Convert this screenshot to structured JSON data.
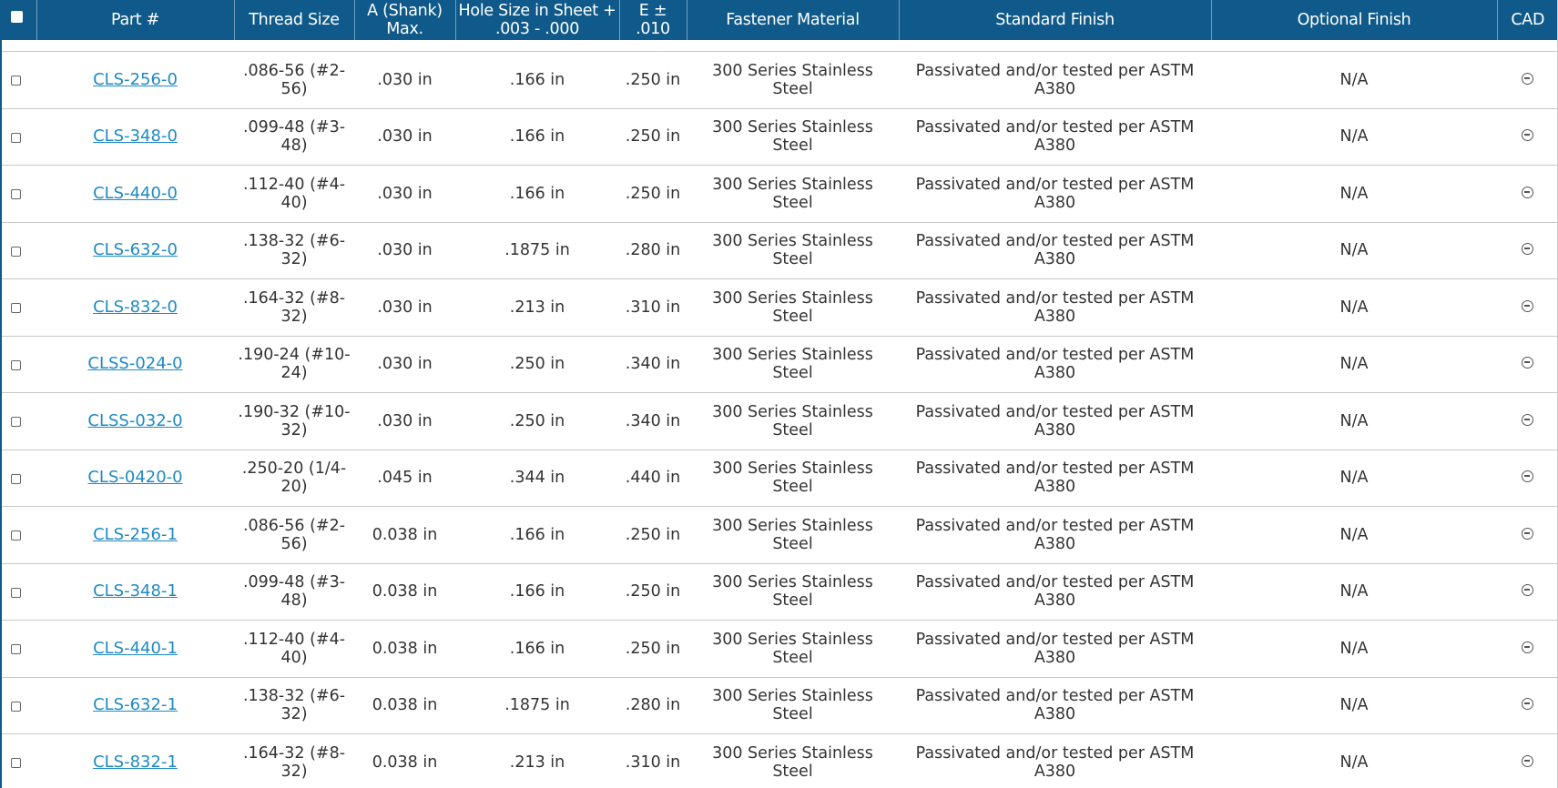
{
  "table": {
    "headers": [
      "",
      "Part #",
      "Thread Size",
      "A (Shank) Max.",
      "Hole Size in Sheet + .003 - .000",
      "E ± .010",
      "Fastener Material",
      "Standard Finish",
      "Optional Finish",
      "CAD"
    ],
    "header_color": "#0f5a8a",
    "link_color": "#1f8ac2",
    "rows": [
      {
        "part": "CLS-256-0",
        "thread": ".086-56 (#2-56)",
        "shank": ".030 in",
        "hole": ".166 in",
        "e": ".250 in",
        "material": "300 Series Stainless Steel",
        "std_finish": "Passivated and/or tested per ASTM A380",
        "opt_finish": "N/A",
        "cad": "cad-icon"
      },
      {
        "part": "CLS-348-0",
        "thread": ".099-48 (#3-48)",
        "shank": ".030 in",
        "hole": ".166 in",
        "e": ".250 in",
        "material": "300 Series Stainless Steel",
        "std_finish": "Passivated and/or tested per ASTM A380",
        "opt_finish": "N/A",
        "cad": "cad-icon"
      },
      {
        "part": "CLS-440-0",
        "thread": ".112-40 (#4-40)",
        "shank": ".030 in",
        "hole": ".166 in",
        "e": ".250 in",
        "material": "300 Series Stainless Steel",
        "std_finish": "Passivated and/or tested per ASTM A380",
        "opt_finish": "N/A",
        "cad": "cad-icon"
      },
      {
        "part": "CLS-632-0",
        "thread": ".138-32 (#6-32)",
        "shank": ".030 in",
        "hole": ".1875 in",
        "e": ".280 in",
        "material": "300 Series Stainless Steel",
        "std_finish": "Passivated and/or tested per ASTM A380",
        "opt_finish": "N/A",
        "cad": "cad-icon"
      },
      {
        "part": "CLS-832-0",
        "thread": ".164-32 (#8-32)",
        "shank": ".030 in",
        "hole": ".213 in",
        "e": ".310 in",
        "material": "300 Series Stainless Steel",
        "std_finish": "Passivated and/or tested per ASTM A380",
        "opt_finish": "N/A",
        "cad": "cad-icon"
      },
      {
        "part": "CLSS-024-0",
        "thread": ".190-24 (#10-24)",
        "shank": ".030 in",
        "hole": ".250 in",
        "e": ".340 in",
        "material": "300 Series Stainless Steel",
        "std_finish": "Passivated and/or tested per ASTM A380",
        "opt_finish": "N/A",
        "cad": "cad-icon"
      },
      {
        "part": "CLSS-032-0",
        "thread": ".190-32 (#10-32)",
        "shank": ".030 in",
        "hole": ".250 in",
        "e": ".340 in",
        "material": "300 Series Stainless Steel",
        "std_finish": "Passivated and/or tested per ASTM A380",
        "opt_finish": "N/A",
        "cad": "cad-icon"
      },
      {
        "part": "CLS-0420-0",
        "thread": ".250-20 (1/4-20)",
        "shank": ".045 in",
        "hole": ".344 in",
        "e": ".440 in",
        "material": "300 Series Stainless Steel",
        "std_finish": "Passivated and/or tested per ASTM A380",
        "opt_finish": "N/A",
        "cad": "cad-icon"
      },
      {
        "part": "CLS-256-1",
        "thread": ".086-56 (#2-56)",
        "shank": "0.038 in",
        "hole": ".166 in",
        "e": ".250 in",
        "material": "300 Series Stainless Steel",
        "std_finish": "Passivated and/or tested per ASTM A380",
        "opt_finish": "N/A",
        "cad": "cad-icon"
      },
      {
        "part": "CLS-348-1",
        "thread": ".099-48 (#3-48)",
        "shank": "0.038 in",
        "hole": ".166 in",
        "e": ".250 in",
        "material": "300 Series Stainless Steel",
        "std_finish": "Passivated and/or tested per ASTM A380",
        "opt_finish": "N/A",
        "cad": "cad-icon"
      },
      {
        "part": "CLS-440-1",
        "thread": ".112-40 (#4-40)",
        "shank": "0.038 in",
        "hole": ".166 in",
        "e": ".250 in",
        "material": "300 Series Stainless Steel",
        "std_finish": "Passivated and/or tested per ASTM A380",
        "opt_finish": "N/A",
        "cad": "cad-icon"
      },
      {
        "part": "CLS-632-1",
        "thread": ".138-32 (#6-32)",
        "shank": "0.038 in",
        "hole": ".1875 in",
        "e": ".280 in",
        "material": "300 Series Stainless Steel",
        "std_finish": "Passivated and/or tested per ASTM A380",
        "opt_finish": "N/A",
        "cad": "cad-icon"
      },
      {
        "part": "CLS-832-1",
        "thread": ".164-32 (#8-32)",
        "shank": "0.038 in",
        "hole": ".213 in",
        "e": ".310 in",
        "material": "300 Series Stainless Steel",
        "std_finish": "Passivated and/or tested per ASTM A380",
        "opt_finish": "N/A",
        "cad": "cad-icon"
      }
    ]
  }
}
